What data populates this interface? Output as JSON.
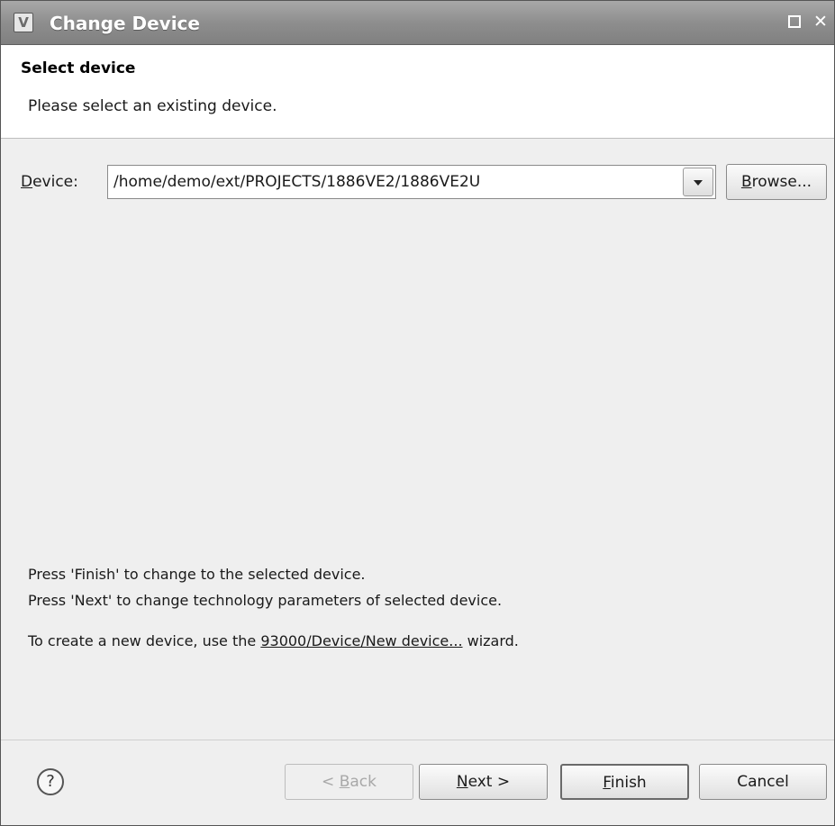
{
  "window": {
    "title": "Change Device",
    "icon": "app-icon",
    "icon_glyph": "V"
  },
  "header": {
    "title": "Select device",
    "description": "Please select an existing device."
  },
  "device": {
    "label_mnemonic": "D",
    "label_rest": "evice:",
    "value": "/home/demo/ext/PROJECTS/1886VE2/1886VE2U",
    "browse_mnemonic": "B",
    "browse_rest": "rowse..."
  },
  "messages": {
    "finish_hint": "Press 'Finish' to change to the selected device.",
    "next_hint": "Press 'Next' to change technology parameters of selected device.",
    "create_prefix": "To create a new device, use the ",
    "create_link": "93000/Device/New device...",
    "create_suffix": " wizard."
  },
  "buttons": {
    "help_glyph": "?",
    "back_prefix": "< ",
    "back_mnemonic": "B",
    "back_rest": "ack",
    "next_mnemonic": "N",
    "next_rest": "ext >",
    "finish_mnemonic": "F",
    "finish_rest": "inish",
    "cancel": "Cancel"
  }
}
